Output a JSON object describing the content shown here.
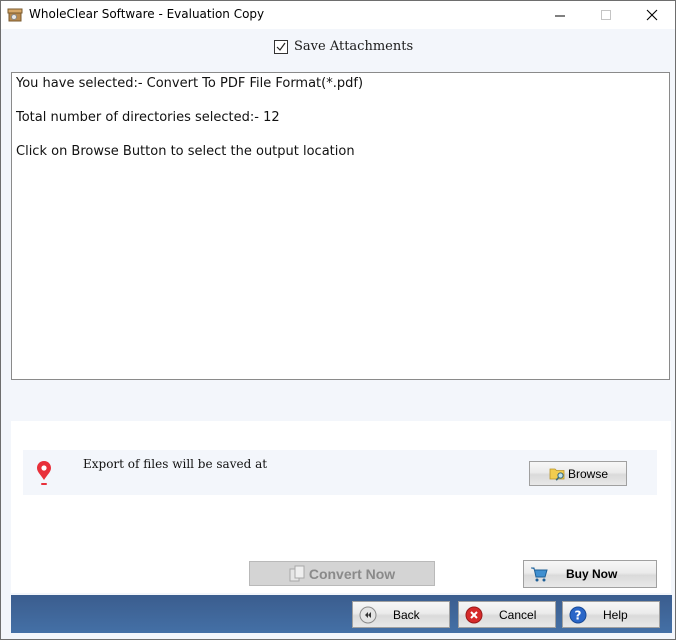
{
  "window": {
    "title": "WholeClear Software - Evaluation Copy",
    "controls": [
      "minimize",
      "maximize",
      "close"
    ]
  },
  "options": {
    "save_attachments_label": "Save Attachments",
    "save_attachments_checked": true
  },
  "log": {
    "lines": [
      "You have selected:- Convert To PDF File Format(*.pdf)",
      "Total number of directories selected:- 12",
      "Click on Browse Button to select the output location"
    ]
  },
  "export": {
    "label": "Export of files will be saved at",
    "browse_label": "Browse"
  },
  "actions": {
    "convert_label": "Convert Now",
    "convert_enabled": false,
    "buy_label": "Buy Now"
  },
  "footer": {
    "back_label": "Back",
    "cancel_label": "Cancel",
    "help_label": "Help"
  },
  "colors": {
    "footer_bar": "#3f65a0",
    "pin": "#e8303a",
    "cancel_icon": "#d62a2a",
    "help_icon": "#2a66c8"
  }
}
